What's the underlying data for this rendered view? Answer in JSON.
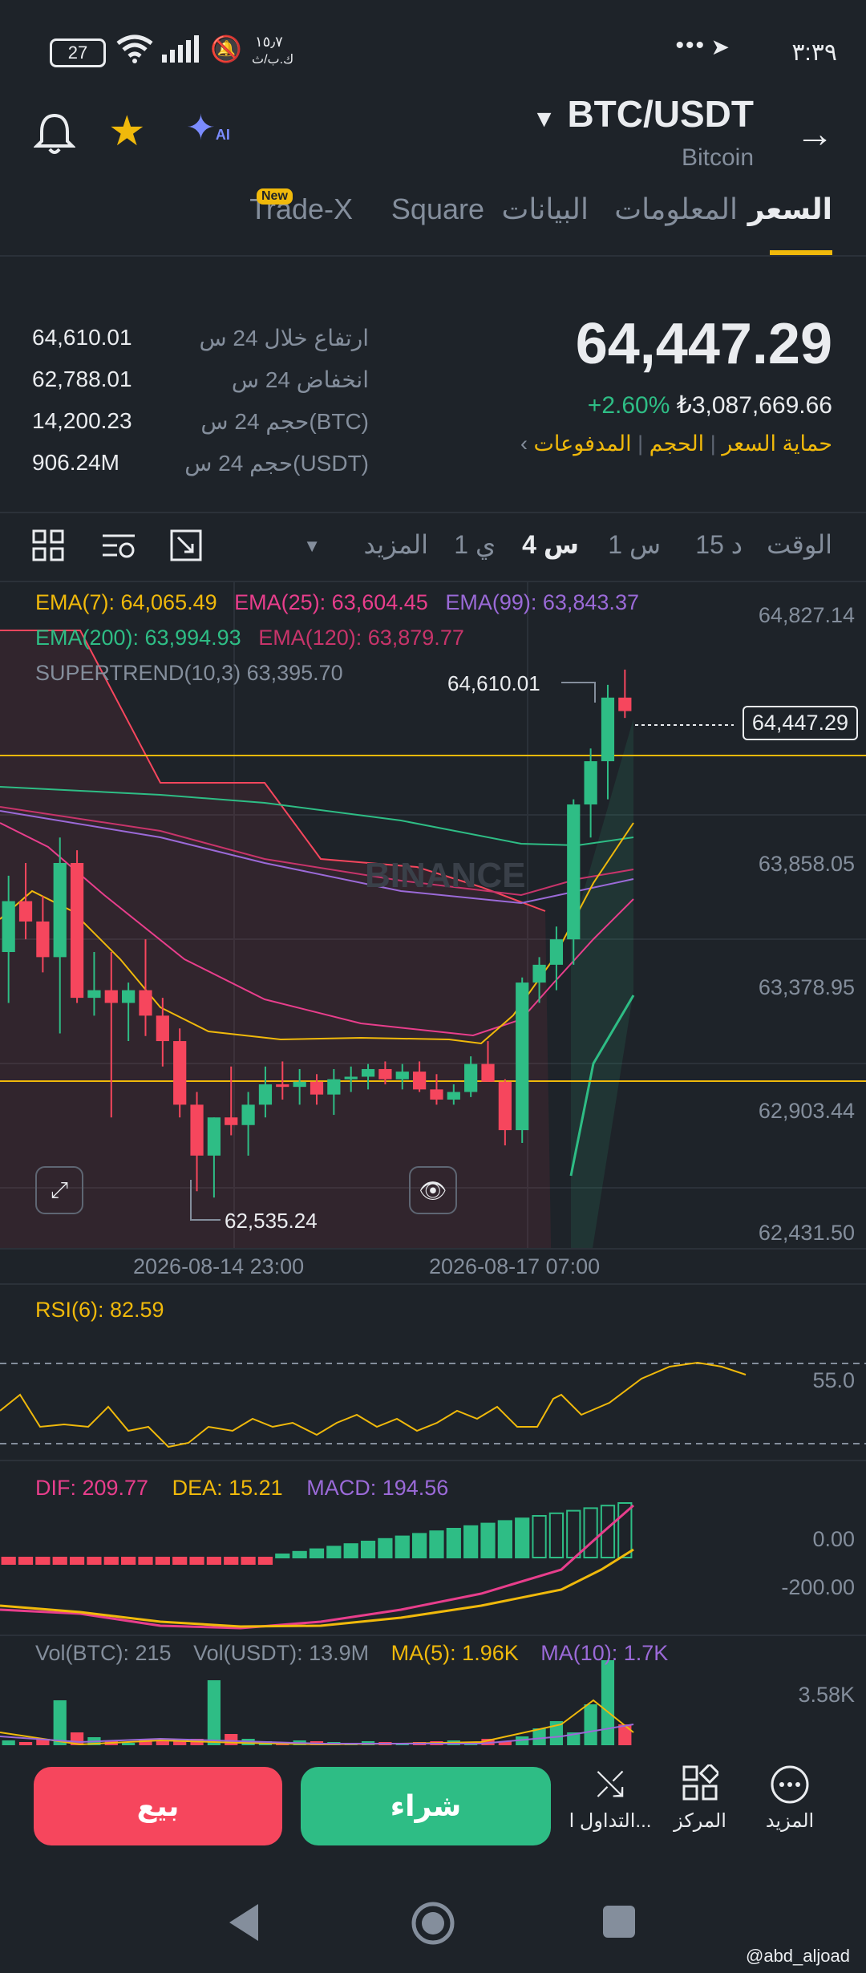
{
  "status_bar": {
    "time": "٣:٣٩",
    "dots": "•••",
    "battery": "27",
    "speed": "١٥٫٧",
    "speed_unit": "ك.ب/ث"
  },
  "header": {
    "pair": "BTC/USDT",
    "name": "Bitcoin",
    "new_badge": "New"
  },
  "tabs": [
    {
      "label": "السعر",
      "active": true
    },
    {
      "label": "المعلومات"
    },
    {
      "label": "البيانات"
    },
    {
      "label": "Square"
    },
    {
      "label": "Trade-X"
    }
  ],
  "price": {
    "last": "64,447.29",
    "change": "+2.60%",
    "fiat": "₺3,087,669.66",
    "links": [
      "المدفوعات",
      "الحجم",
      "حماية السعر"
    ]
  },
  "stats": [
    {
      "label": "ارتفاع خلال 24 س",
      "value": "64,610.01"
    },
    {
      "label": "انخفاض 24 س",
      "value": "62,788.01"
    },
    {
      "label": "حجم 24 س(BTC)",
      "value": "14,200.23"
    },
    {
      "label": "حجم 24 س(USDT)",
      "value": "906.24M"
    }
  ],
  "timeframes": {
    "time": "الوقت",
    "m15": "15 د",
    "h1": "1 س",
    "h4": "4 س",
    "d1": "1 ي",
    "more": "المزيد"
  },
  "indicators": {
    "ema7": "EMA(7): 64,065.49",
    "ema25": "EMA(25): 63,604.45",
    "ema99": "EMA(99): 63,843.37",
    "ema200": "EMA(200): 63,994.93",
    "ema120": "EMA(120): 63,879.77",
    "supertrend": "SUPERTREND(10,3) 63,395.70"
  },
  "chart_data": {
    "type": "candlestick",
    "y_ticks": [
      "64,827.14",
      "63,858.05",
      "63,378.95",
      "62,903.44",
      "62,431.50"
    ],
    "current_price_tag": "64,447.29",
    "high_marker": "64,610.01",
    "low_marker": "62,535.24",
    "x_labels": [
      "2026-08-14 23:00",
      "2026-08-17 07:00"
    ],
    "watermark": "BINANCE",
    "candles": [
      {
        "o": 63500,
        "h": 63800,
        "l": 63300,
        "c": 63700
      },
      {
        "o": 63700,
        "h": 63850,
        "l": 63550,
        "c": 63620
      },
      {
        "o": 63620,
        "h": 63720,
        "l": 63420,
        "c": 63480
      },
      {
        "o": 63480,
        "h": 63950,
        "l": 63180,
        "c": 63850
      },
      {
        "o": 63850,
        "h": 63900,
        "l": 63300,
        "c": 63320
      },
      {
        "o": 63320,
        "h": 63500,
        "l": 63250,
        "c": 63350
      },
      {
        "o": 63350,
        "h": 63500,
        "l": 62850,
        "c": 63300
      },
      {
        "o": 63300,
        "h": 63380,
        "l": 63150,
        "c": 63350
      },
      {
        "o": 63350,
        "h": 63550,
        "l": 63170,
        "c": 63250
      },
      {
        "o": 63250,
        "h": 63320,
        "l": 63050,
        "c": 63150
      },
      {
        "o": 63150,
        "h": 63200,
        "l": 62850,
        "c": 62900
      },
      {
        "o": 62900,
        "h": 62950,
        "l": 62560,
        "c": 62700
      },
      {
        "o": 62700,
        "h": 62850,
        "l": 62535,
        "c": 62850
      },
      {
        "o": 62850,
        "h": 63050,
        "l": 62780,
        "c": 62820
      },
      {
        "o": 62820,
        "h": 62950,
        "l": 62700,
        "c": 62900
      },
      {
        "o": 62900,
        "h": 63050,
        "l": 62850,
        "c": 62980
      },
      {
        "o": 62980,
        "h": 63070,
        "l": 62920,
        "c": 62970
      },
      {
        "o": 62970,
        "h": 63040,
        "l": 62900,
        "c": 62990
      },
      {
        "o": 62990,
        "h": 63020,
        "l": 62900,
        "c": 62940
      },
      {
        "o": 62940,
        "h": 63040,
        "l": 62860,
        "c": 63000
      },
      {
        "o": 63000,
        "h": 63050,
        "l": 62950,
        "c": 63010
      },
      {
        "o": 63010,
        "h": 63060,
        "l": 62960,
        "c": 63040
      },
      {
        "o": 63040,
        "h": 63070,
        "l": 62980,
        "c": 63000
      },
      {
        "o": 63000,
        "h": 63060,
        "l": 62960,
        "c": 63030
      },
      {
        "o": 63030,
        "h": 63070,
        "l": 62950,
        "c": 62960
      },
      {
        "o": 62960,
        "h": 63020,
        "l": 62900,
        "c": 62920
      },
      {
        "o": 62920,
        "h": 62980,
        "l": 62900,
        "c": 62950
      },
      {
        "o": 62950,
        "h": 63090,
        "l": 62930,
        "c": 63060
      },
      {
        "o": 63060,
        "h": 63150,
        "l": 62990,
        "c": 62990
      },
      {
        "o": 62990,
        "h": 63000,
        "l": 62740,
        "c": 62800
      },
      {
        "o": 62800,
        "h": 63400,
        "l": 62750,
        "c": 63380
      },
      {
        "o": 63380,
        "h": 63480,
        "l": 63300,
        "c": 63450
      },
      {
        "o": 63450,
        "h": 63600,
        "l": 63350,
        "c": 63550
      },
      {
        "o": 63550,
        "h": 64100,
        "l": 63450,
        "c": 64080
      },
      {
        "o": 64080,
        "h": 64300,
        "l": 63950,
        "c": 64250
      },
      {
        "o": 64250,
        "h": 64550,
        "l": 64100,
        "c": 64500
      },
      {
        "o": 64500,
        "h": 64610,
        "l": 64420,
        "c": 64447
      }
    ]
  },
  "rsi": {
    "label": "RSI(6): 82.59",
    "level": "55.0"
  },
  "macd": {
    "dif": "DIF: 209.77",
    "dea": "DEA: 15.21",
    "macd": "MACD: 194.56",
    "t0": "0.00",
    "t1": "-200.00"
  },
  "volume": {
    "btc": "Vol(BTC): 215",
    "usdt": "Vol(USDT): 13.9M",
    "ma5": "MA(5): 1.96K",
    "ma10": "MA(10): 1.7K",
    "max": "3.58K"
  },
  "actions": {
    "sell": "بيع",
    "buy": "شراء",
    "trade": "التداول ا...",
    "center": "المركز",
    "more": "المزيد"
  },
  "watermark_user": "@abd_aljoad",
  "colors": {
    "up": "#2ebd85",
    "down": "#f6465d",
    "accent": "#f0b90b",
    "bg": "#1e2329"
  }
}
